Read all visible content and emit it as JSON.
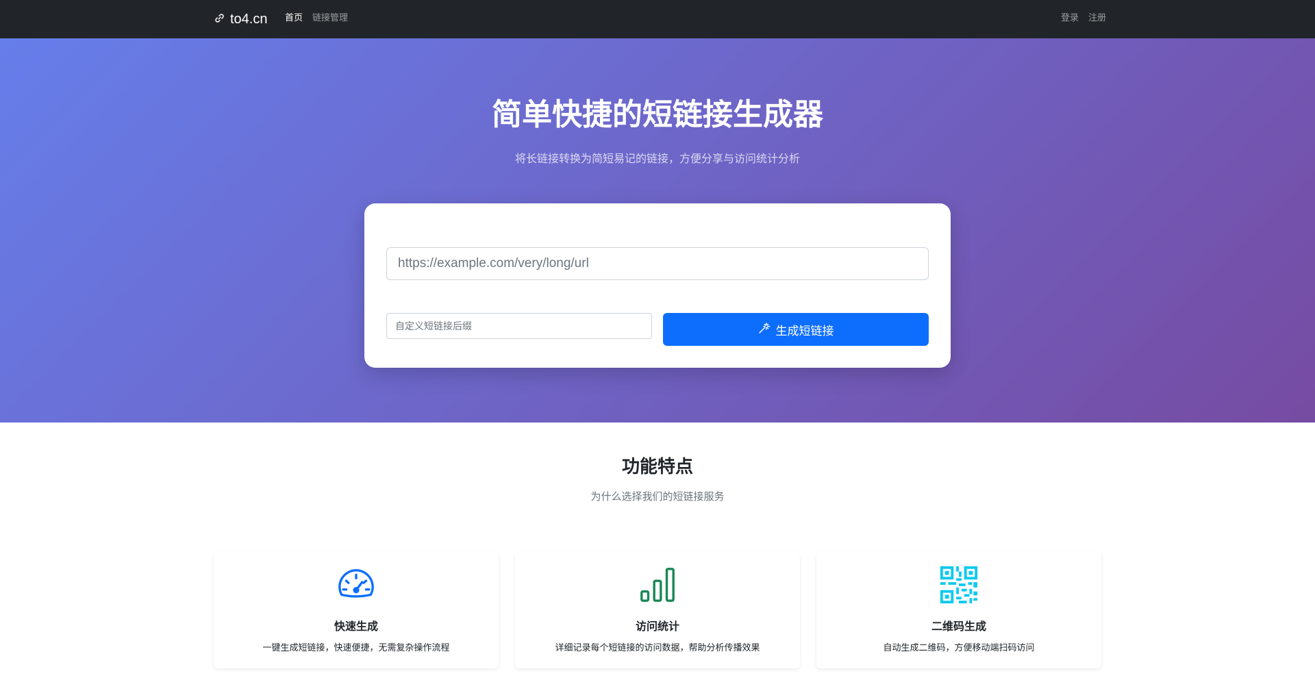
{
  "navbar": {
    "brand": "to4.cn",
    "left_links": [
      {
        "label": "首页",
        "active": true
      },
      {
        "label": "链接管理",
        "active": false
      }
    ],
    "right_links": [
      {
        "label": "登录"
      },
      {
        "label": "注册"
      }
    ]
  },
  "hero": {
    "title": "简单快捷的短链接生成器",
    "subtitle": "将长链接转换为简短易记的链接，方便分享与访问统计分析",
    "url_placeholder": "https://example.com/very/long/url",
    "alias_placeholder": "自定义短链接后缀",
    "submit_label": "生成短链接"
  },
  "features": {
    "title": "功能特点",
    "subtitle": "为什么选择我们的短链接服务",
    "cards": [
      {
        "icon": "speedometer-icon",
        "title": "快速生成",
        "text": "一键生成短链接，快速便捷，无需复杂操作流程",
        "color": "#0d6efd"
      },
      {
        "icon": "bar-chart-icon",
        "title": "访问统计",
        "text": "详细记录每个短链接的访问数据，帮助分析传播效果",
        "color": "#198754"
      },
      {
        "icon": "qr-code-icon",
        "title": "二维码生成",
        "text": "自动生成二维码，方便移动端扫码访问",
        "color": "#0dcaf0"
      }
    ]
  }
}
